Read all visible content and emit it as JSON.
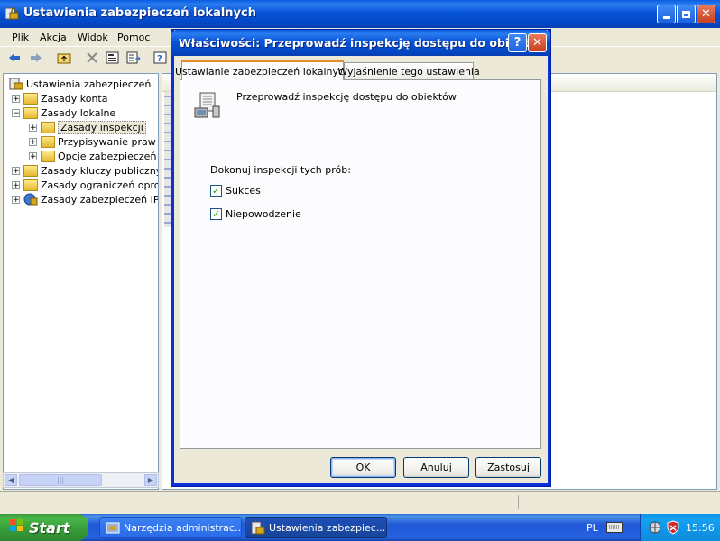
{
  "main_window": {
    "title": "Ustawienia zabezpieczeń lokalnych",
    "menu": [
      "Plik",
      "Akcja",
      "Widok",
      "Pomoc"
    ]
  },
  "tree": {
    "items": [
      {
        "label": "Ustawienia zabezpieczeń",
        "expander": ""
      },
      {
        "label": "Zasady konta",
        "expander": "+"
      },
      {
        "label": "Zasady lokalne",
        "expander": "−"
      },
      {
        "label": "Zasady inspekcji",
        "expander": "+"
      },
      {
        "label": "Przypisywanie praw użytkownika",
        "expander": "+"
      },
      {
        "label": "Opcje zabezpieczeń",
        "expander": "+"
      },
      {
        "label": "Zasady kluczy publicznych",
        "expander": "+"
      },
      {
        "label": "Zasady ograniczeń oprogramowania",
        "expander": "+"
      },
      {
        "label": "Zasady zabezpieczeń IP w",
        "expander": "+"
      }
    ],
    "scroll_grip": "|||"
  },
  "dialog": {
    "title": "Właściwości: Przeprowadź inspekcję dostępu do obiektów",
    "help_glyph": "?",
    "close_glyph": "✕",
    "tabs": [
      "Ustawianie zabezpieczeń lokalnych",
      "Wyjaśnienie tego ustawienia"
    ],
    "policy_name": "Przeprowadź inspekcję dostępu do obiektów",
    "audit_label": "Dokonuj inspekcji tych prób:",
    "checkboxes": [
      {
        "label": "Sukces",
        "checked": true
      },
      {
        "label": "Niepowodzenie",
        "checked": true
      }
    ],
    "buttons": {
      "ok": "OK",
      "cancel": "Anuluj",
      "apply": "Zastosuj"
    }
  },
  "taskbar": {
    "start": "Start",
    "items": [
      "Narzędzia administrac...",
      "Ustawienia zabezpiec..."
    ],
    "language": "PL",
    "clock": "15:56"
  },
  "colors": {
    "titlebar": "#0a5de0",
    "tab_highlight": "#e68b2c",
    "checkmark": "#21a121"
  }
}
